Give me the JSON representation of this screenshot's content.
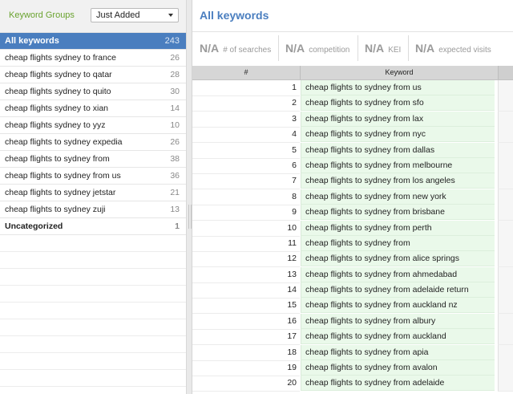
{
  "left": {
    "title": "Keyword Groups",
    "sort_value": "Just Added",
    "groups": [
      {
        "label": "All keywords",
        "count": "243"
      },
      {
        "label": "cheap flights sydney to france",
        "count": "26"
      },
      {
        "label": "cheap flights sydney to qatar",
        "count": "28"
      },
      {
        "label": "cheap flights sydney to quito",
        "count": "30"
      },
      {
        "label": "cheap flights sydney to xian",
        "count": "14"
      },
      {
        "label": "cheap flights sydney to yyz",
        "count": "10"
      },
      {
        "label": "cheap flights to sydney expedia",
        "count": "26"
      },
      {
        "label": "cheap flights to sydney from",
        "count": "38"
      },
      {
        "label": "cheap flights to sydney from us",
        "count": "36"
      },
      {
        "label": "cheap flights to sydney jetstar",
        "count": "21"
      },
      {
        "label": "cheap flights to sydney zuji",
        "count": "13"
      },
      {
        "label": "Uncategorized",
        "count": "1"
      }
    ]
  },
  "right": {
    "title": "All keywords",
    "metrics": [
      {
        "value": "N/A",
        "label": "# of searches"
      },
      {
        "value": "N/A",
        "label": "competition"
      },
      {
        "value": "N/A",
        "label": "KEI"
      },
      {
        "value": "N/A",
        "label": "expected visits"
      }
    ],
    "columns": {
      "num": "#",
      "keyword": "Keyword"
    },
    "rows": [
      {
        "num": "1",
        "keyword": "cheap flights to sydney from us"
      },
      {
        "num": "2",
        "keyword": "cheap flights to sydney from sfo"
      },
      {
        "num": "3",
        "keyword": "cheap flights to sydney from lax"
      },
      {
        "num": "4",
        "keyword": "cheap flights to sydney from nyc"
      },
      {
        "num": "5",
        "keyword": "cheap flights to sydney from dallas"
      },
      {
        "num": "6",
        "keyword": "cheap flights to sydney from melbourne"
      },
      {
        "num": "7",
        "keyword": "cheap flights to sydney from los angeles"
      },
      {
        "num": "8",
        "keyword": "cheap flights to sydney from new york"
      },
      {
        "num": "9",
        "keyword": "cheap flights to sydney from brisbane"
      },
      {
        "num": "10",
        "keyword": "cheap flights to sydney from perth"
      },
      {
        "num": "11",
        "keyword": "cheap flights to sydney from"
      },
      {
        "num": "12",
        "keyword": "cheap flights to sydney from alice springs"
      },
      {
        "num": "13",
        "keyword": "cheap flights to sydney from ahmedabad"
      },
      {
        "num": "14",
        "keyword": "cheap flights to sydney from adelaide return"
      },
      {
        "num": "15",
        "keyword": "cheap flights to sydney from auckland nz"
      },
      {
        "num": "16",
        "keyword": "cheap flights to sydney from albury"
      },
      {
        "num": "17",
        "keyword": "cheap flights to sydney from auckland"
      },
      {
        "num": "18",
        "keyword": "cheap flights to sydney from apia"
      },
      {
        "num": "19",
        "keyword": "cheap flights to sydney from avalon"
      },
      {
        "num": "20",
        "keyword": "cheap flights to sydney from adelaide"
      }
    ]
  }
}
